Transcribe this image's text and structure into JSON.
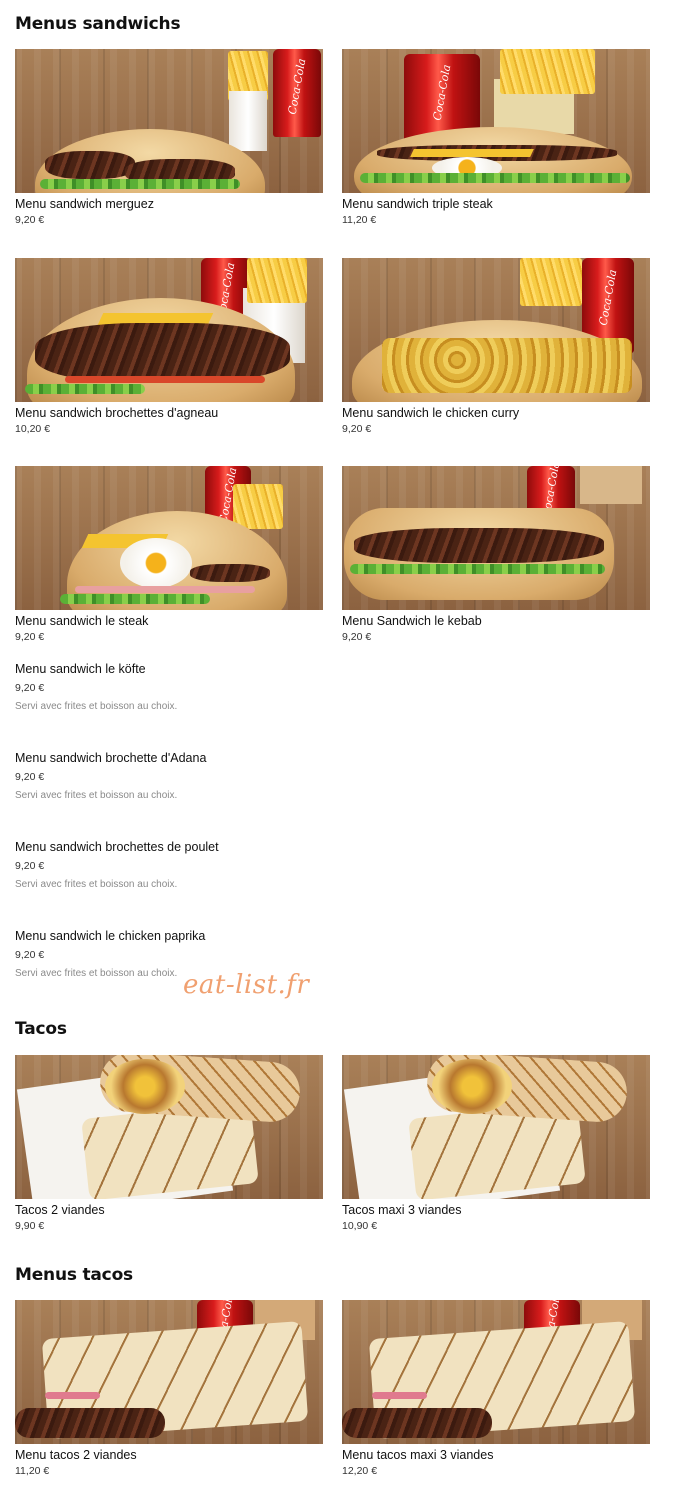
{
  "sections": {
    "menus_sandwichs": "Menus sandwichs",
    "tacos": "Tacos",
    "menus_tacos": "Menus tacos"
  },
  "menus_sandwichs_cards": [
    {
      "name": "Menu sandwich merguez",
      "price": "9,20 €"
    },
    {
      "name": "Menu sandwich triple steak",
      "price": "11,20 €"
    },
    {
      "name": "Menu sandwich brochettes d'agneau",
      "price": "10,20 €"
    },
    {
      "name": "Menu sandwich le chicken curry",
      "price": "9,20 €"
    },
    {
      "name": "Menu sandwich le steak",
      "price": "9,20 €"
    },
    {
      "name": "Menu Sandwich le kebab",
      "price": "9,20 €"
    }
  ],
  "menus_sandwichs_list": [
    {
      "name": "Menu sandwich le köfte",
      "price": "9,20 €",
      "description": "Servi avec frites et boisson au choix."
    },
    {
      "name": "Menu sandwich brochette d'Adana",
      "price": "9,20 €",
      "description": "Servi avec frites et boisson au choix."
    },
    {
      "name": "Menu sandwich brochettes de poulet",
      "price": "9,20 €",
      "description": "Servi avec frites et boisson au choix."
    },
    {
      "name": "Menu sandwich le chicken paprika",
      "price": "9,20 €",
      "description": "Servi avec frites et boisson au choix."
    }
  ],
  "tacos_cards": [
    {
      "name": "Tacos 2 viandes",
      "price": "9,90 €"
    },
    {
      "name": "Tacos maxi 3 viandes",
      "price": "10,90 €"
    }
  ],
  "menus_tacos_cards": [
    {
      "name": "Menu tacos 2 viandes",
      "price": "11,20 €"
    },
    {
      "name": "Menu tacos maxi 3 viandes",
      "price": "12,20 €"
    }
  ],
  "watermark": "eat-list.fr",
  "can_brand": "Coca-Cola"
}
